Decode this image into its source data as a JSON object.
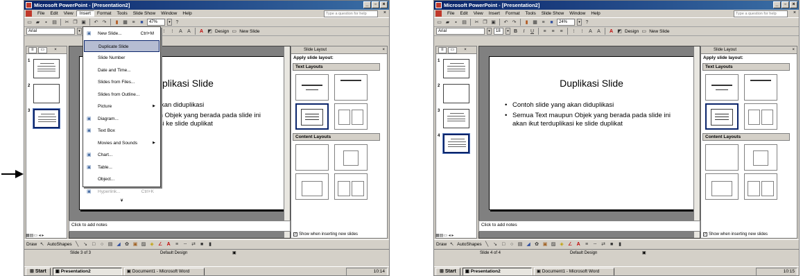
{
  "windows": [
    {
      "id": "w1",
      "title": "Microsoft PowerPoint - [Presentation2]",
      "menus": [
        "File",
        "Edit",
        "View",
        "Insert",
        "Format",
        "Tools",
        "Slide Show",
        "Window",
        "Help"
      ],
      "active_menu_index": 3,
      "question_placeholder": "Type a question for help",
      "font": "Arial",
      "font_size": "",
      "zoom": "47%",
      "design_label": "Design",
      "new_slide_label": "New Slide",
      "slide": {
        "title": "Duplikasi Slide",
        "bullets": [
          "Contoh slide yang akan diduplikasi",
          "Semua Text maupun Objek yang berada pada slide ini akan ikut terduplikasi ke slide duplikat"
        ]
      },
      "thumbnails": [
        "1",
        "2",
        "3"
      ],
      "selected_thumb": 2,
      "notes": "Click to add notes",
      "status": {
        "slide": "Slide 3 of 3",
        "design": "Default Design"
      },
      "clock": "10:14",
      "insert_menu": [
        {
          "label": "New Slide...",
          "shortcut": "Ctrl+M",
          "icon": "new-slide-icon"
        },
        {
          "label": "Duplicate Slide",
          "shortcut": "",
          "highlight": true
        },
        {
          "label": "Slide Number",
          "shortcut": ""
        },
        {
          "label": "Date and Time...",
          "shortcut": ""
        },
        {
          "label": "Slides from Files...",
          "shortcut": ""
        },
        {
          "label": "Slides from Outline...",
          "shortcut": ""
        },
        {
          "label": "Picture",
          "shortcut": "",
          "submenu": true
        },
        {
          "label": "Diagram...",
          "shortcut": "",
          "icon": "diagram-icon"
        },
        {
          "label": "Text Box",
          "shortcut": "",
          "icon": "textbox-icon"
        },
        {
          "label": "Movies and Sounds",
          "shortcut": "",
          "submenu": true
        },
        {
          "label": "Chart...",
          "shortcut": "",
          "icon": "chart-icon"
        },
        {
          "label": "Table...",
          "shortcut": "",
          "icon": "table-icon"
        },
        {
          "label": "Object...",
          "shortcut": ""
        },
        {
          "label": "Hyperlink...",
          "shortcut": "Ctrl+K",
          "disabled": true,
          "icon": "hyperlink-icon"
        }
      ]
    },
    {
      "id": "w2",
      "title": "Microsoft PowerPoint - [Presentation2]",
      "menus": [
        "File",
        "Edit",
        "View",
        "Insert",
        "Format",
        "Tools",
        "Slide Show",
        "Window",
        "Help"
      ],
      "active_menu_index": -1,
      "question_placeholder": "Type a question for help",
      "font": "Arial",
      "font_size": "18",
      "zoom": "24%",
      "design_label": "Design",
      "new_slide_label": "New Slide",
      "slide": {
        "title": "Duplikasi Slide",
        "bullets": [
          "Contoh slide yang akan diduplikasi",
          "Semua Text maupun Objek yang berada pada slide ini akan ikut terduplikasi ke slide duplikat"
        ]
      },
      "thumbnails": [
        "1",
        "2",
        "3",
        "4"
      ],
      "selected_thumb": 3,
      "notes": "Click to add notes",
      "status": {
        "slide": "Slide 4 of 4",
        "design": "Default Design"
      },
      "clock": "10:15"
    }
  ],
  "taskpane": {
    "title": "Slide Layout",
    "apply_label": "Apply slide layout:",
    "text_layouts": "Text Layouts",
    "content_layouts": "Content Layouts",
    "show_label": "Show when inserting new slides"
  },
  "drawbar": {
    "draw": "Draw",
    "autoshapes": "AutoShapes"
  },
  "taskbar": {
    "start": "Start",
    "ppt": "Presentation2",
    "word": "Document1 - Microsoft Word"
  },
  "colors": {
    "titlebar": "#0a246a",
    "menu_highlight": "#b6bdd2",
    "chrome": "#d4d0c8"
  }
}
